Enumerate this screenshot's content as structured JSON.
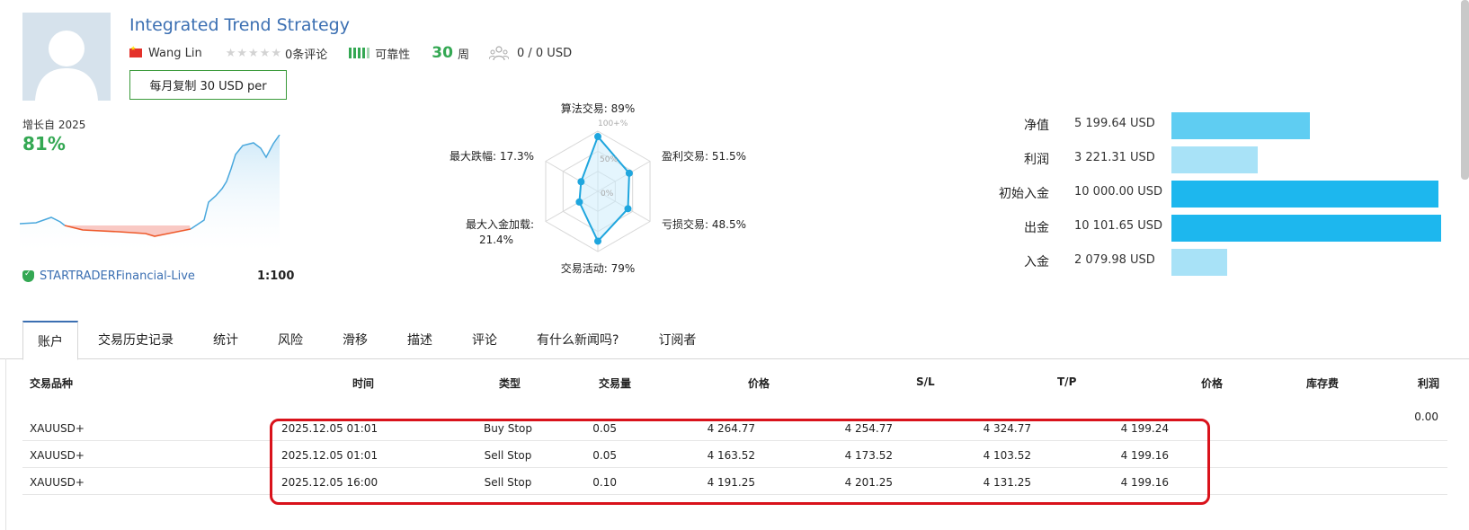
{
  "header": {
    "title": "Integrated Trend Strategy",
    "author": "Wang Lin",
    "reviews": "0条评论",
    "reliability": "可靠性",
    "weeks_num": "30",
    "weeks_unit": "周",
    "subscribers": "0 / 0 USD",
    "copy_button": "每月复制 30 USD per"
  },
  "growth": {
    "label": "增长自 2025",
    "value": "81%",
    "broker": "STARTRADERFinancial-Live",
    "leverage": "1:100"
  },
  "radar": {
    "algo": "算法交易: 89%",
    "profit_trades": "盈利交易: 51.5%",
    "loss_trades": "亏损交易: 48.5%",
    "activity": "交易活动: 79%",
    "max_deposit_load_1": "最大入金加载:",
    "max_deposit_load_2": "21.4%",
    "max_drawdown": "最大跌幅: 17.3%",
    "tick_100": "100+%",
    "tick_50": "50%",
    "tick_0": "0%",
    "values": [
      89,
      51.5,
      48.5,
      79,
      21.4,
      17.3
    ]
  },
  "balance": {
    "rows": [
      {
        "label": "净值",
        "value": "5 199.64 USD",
        "amount": 5199.64,
        "color": "#5fcdf2"
      },
      {
        "label": "利润",
        "value": "3 221.31 USD",
        "amount": 3221.31,
        "color": "#a8e2f7"
      },
      {
        "label": "初始入金",
        "value": "10 000.00 USD",
        "amount": 10000.0,
        "color": "#1db7ee"
      },
      {
        "label": "出金",
        "value": "10 101.65 USD",
        "amount": 10101.65,
        "color": "#1db7ee"
      },
      {
        "label": "入金",
        "value": "2 079.98 USD",
        "amount": 2079.98,
        "color": "#a8e2f7"
      }
    ]
  },
  "tabs": [
    "账户",
    "交易历史记录",
    "统计",
    "风险",
    "滑移",
    "描述",
    "评论",
    "有什么新闻吗?",
    "订阅者"
  ],
  "table": {
    "headers": {
      "symbol": "交易品种",
      "time": "时间",
      "type": "类型",
      "volume": "交易量",
      "price": "价格",
      "sl": "S/L",
      "tp": "T/P",
      "price2": "价格",
      "swap": "库存费",
      "profit": "利润"
    },
    "total_profit": "0.00",
    "rows": [
      {
        "symbol": "XAUUSD+",
        "time": "2025.12.05 01:01",
        "type": "Buy Stop",
        "volume": "0.05",
        "price": "4 264.77",
        "sl": "4 254.77",
        "tp": "4 324.77",
        "price2": "4 199.24"
      },
      {
        "symbol": "XAUUSD+",
        "time": "2025.12.05 01:01",
        "type": "Sell Stop",
        "volume": "0.05",
        "price": "4 163.52",
        "sl": "4 173.52",
        "tp": "4 103.52",
        "price2": "4 199.16"
      },
      {
        "symbol": "XAUUSD+",
        "time": "2025.12.05 16:00",
        "type": "Sell Stop",
        "volume": "0.10",
        "price": "4 191.25",
        "sl": "4 201.25",
        "tp": "4 131.25",
        "price2": "4 199.16"
      }
    ]
  },
  "icons": {
    "flag": "china-flag-icon",
    "stars": "star-icon",
    "subscribers": "subscribers-icon",
    "verified": "verified-shield-icon"
  }
}
